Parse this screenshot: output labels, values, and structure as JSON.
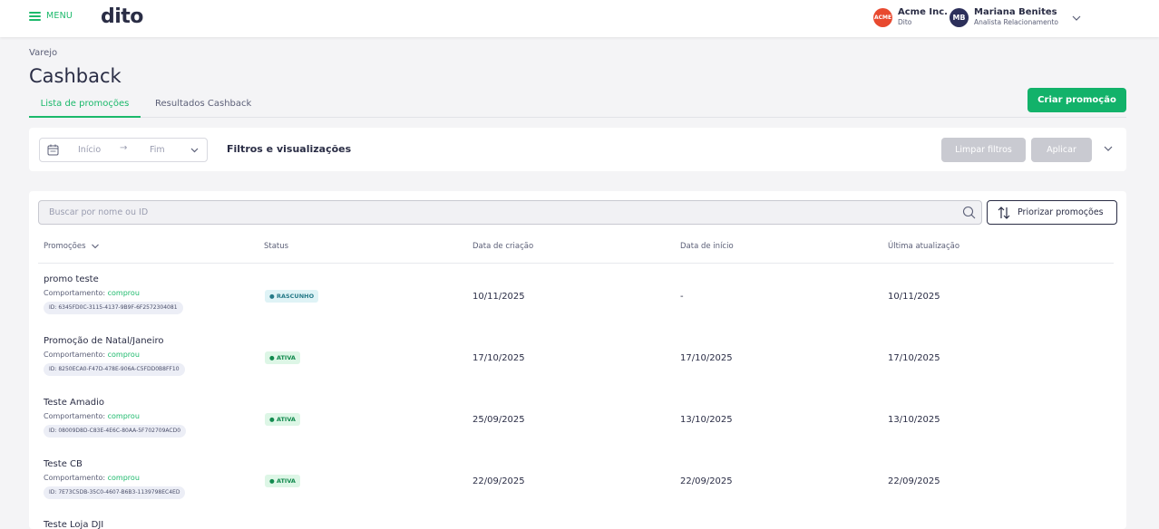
{
  "topbar": {
    "menu_label": "MENU",
    "logo": "dito",
    "account": {
      "avatar_text": "ACME",
      "name": "Acme Inc.",
      "sub": "Dito",
      "color": "#e8492f"
    },
    "user": {
      "initials": "MB",
      "name": "Mariana Benites",
      "role": "Analista Relacionamento"
    }
  },
  "breadcrumb": "Varejo",
  "page_title": "Cashback",
  "tabs": [
    {
      "label": "Lista de promoções",
      "active": true
    },
    {
      "label": "Resultados Cashback",
      "active": false
    }
  ],
  "create_button": "Criar promoção",
  "filters": {
    "date_start_placeholder": "Início",
    "date_arrow": "→",
    "date_end_placeholder": "Fim",
    "title": "Filtros e visualizações",
    "clear_label": "Limpar filtros",
    "apply_label": "Aplicar"
  },
  "search": {
    "placeholder": "Buscar por nome ou ID"
  },
  "prioritize_button": "Priorizar promoções",
  "table": {
    "columns": [
      "Promoções",
      "Status",
      "Data de criação",
      "Data de início",
      "Última atualização"
    ],
    "behavior_prefix": "Comportamento:",
    "rows": [
      {
        "name": "promo teste",
        "behavior": "comprou",
        "id": "ID: 6345FD0C-3115-4137-9B9F-6F2572304081",
        "status": "RASCUNHO",
        "created": "10/11/2025",
        "start": "-",
        "updated": "10/11/2025"
      },
      {
        "name": "Promoção de Natal/Janeiro",
        "behavior": "comprou",
        "id": "ID: 8250ECA0-F47D-478E-906A-C5FDD0B8FF10",
        "status": "ATIVA",
        "created": "17/10/2025",
        "start": "17/10/2025",
        "updated": "17/10/2025"
      },
      {
        "name": "Teste Amadio",
        "behavior": "comprou",
        "id": "ID: 08009D8D-C83E-4E6C-80AA-5F702709ACD0",
        "status": "ATIVA",
        "created": "25/09/2025",
        "start": "13/10/2025",
        "updated": "13/10/2025"
      },
      {
        "name": "Teste CB",
        "behavior": "comprou",
        "id": "ID: 7E73C5DB-35C0-4607-B6B3-1139798EC4ED",
        "status": "ATIVA",
        "created": "22/09/2025",
        "start": "22/09/2025",
        "updated": "22/09/2025"
      },
      {
        "name": "Teste Loja DJI"
      }
    ]
  },
  "colors": {
    "accent": "#1bb96b",
    "primary_button": "#12b26a",
    "text": "#2a2d45"
  }
}
